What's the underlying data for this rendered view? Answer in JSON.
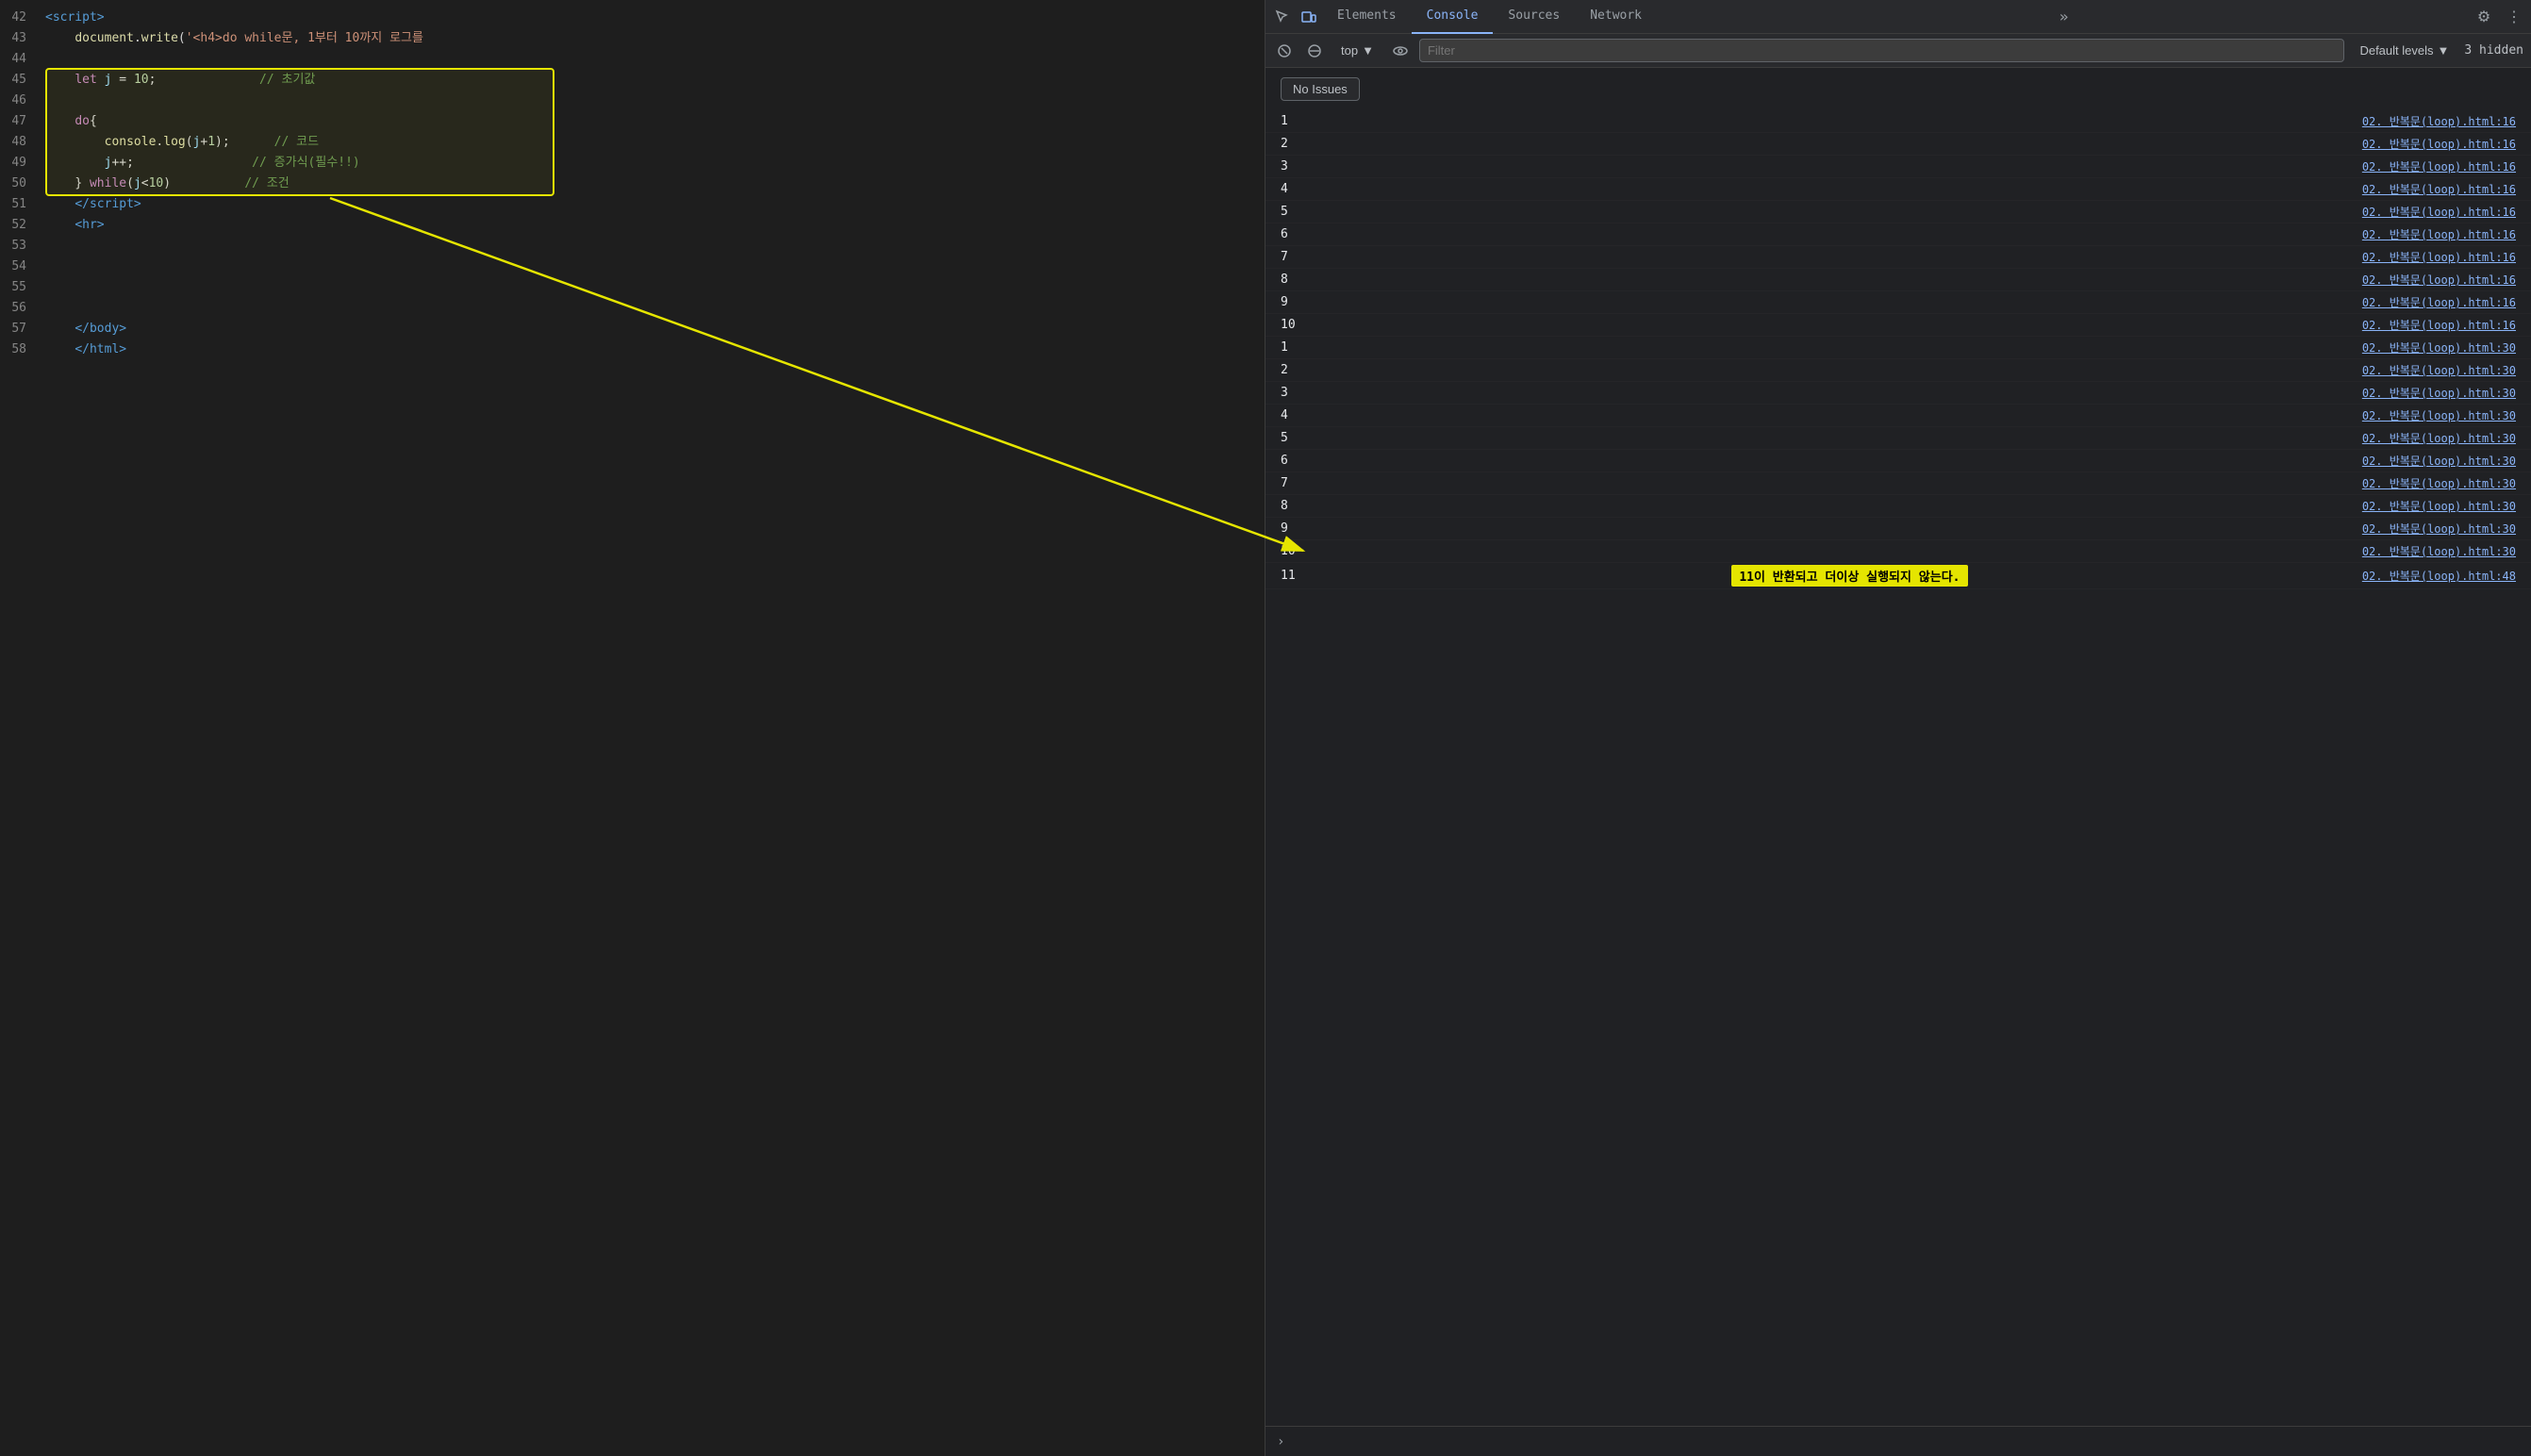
{
  "editor": {
    "lines": [
      {
        "num": 42,
        "html": "<span class='tag'>&lt;script&gt;</span>"
      },
      {
        "num": 43,
        "html": "    <span class='fn'>document</span><span class='op'>.</span><span class='fn'>write</span><span class='op'>(</span><span class='str'>'&lt;h4&gt;do while문, 1부터 10까지 로그를</span>"
      },
      {
        "num": 44,
        "html": ""
      },
      {
        "num": 45,
        "html": "    <span class='kw'>let</span> <span class='var'>j</span> <span class='op'>=</span> <span class='num'>10</span><span class='op'>;</span>              <span class='comment'>// 초기값</span>"
      },
      {
        "num": 46,
        "html": ""
      },
      {
        "num": 47,
        "html": "    <span class='kw'>do</span><span class='op'>{</span>"
      },
      {
        "num": 48,
        "html": "        <span class='fn'>console</span><span class='op'>.</span><span class='fn'>log</span><span class='op'>(</span><span class='var'>j</span><span class='op'>+</span><span class='num'>1</span><span class='op'>);</span>      <span class='comment'>// 코드</span>"
      },
      {
        "num": 49,
        "html": "        <span class='var'>j</span><span class='op'>++;</span>                <span class='comment'>// 증가식(필수!!)</span>"
      },
      {
        "num": 50,
        "html": "    <span class='op'>}</span> <span class='kw'>while</span><span class='op'>(</span><span class='var'>j</span><span class='op'>&lt;</span><span class='num'>10</span><span class='op'>)</span>          <span class='comment'>// 조건</span>"
      },
      {
        "num": 51,
        "html": "    <span class='tag'>&lt;/script&gt;</span>"
      },
      {
        "num": 52,
        "html": "    <span class='tag'>&lt;hr&gt;</span>"
      },
      {
        "num": 53,
        "html": ""
      },
      {
        "num": 54,
        "html": ""
      },
      {
        "num": 55,
        "html": ""
      },
      {
        "num": 56,
        "html": ""
      },
      {
        "num": 57,
        "html": "    <span class='tag'>&lt;/body&gt;</span>"
      },
      {
        "num": 58,
        "html": "    <span class='tag'>&lt;/html&gt;</span>"
      }
    ]
  },
  "devtools": {
    "tabs": [
      "Elements",
      "Console",
      "Sources",
      "Network"
    ],
    "active_tab": "Console",
    "toolbar": {
      "top_label": "top",
      "filter_placeholder": "Filter",
      "default_levels": "Default levels",
      "hidden_count": "3 hidden"
    },
    "no_issues": "No Issues",
    "console_rows": [
      {
        "value": "1",
        "source": "02. 반복문(loop).html:16"
      },
      {
        "value": "2",
        "source": "02. 반복문(loop).html:16"
      },
      {
        "value": "3",
        "source": "02. 반복문(loop).html:16"
      },
      {
        "value": "4",
        "source": "02. 반복문(loop).html:16"
      },
      {
        "value": "5",
        "source": "02. 반복문(loop).html:16"
      },
      {
        "value": "6",
        "source": "02. 반복문(loop).html:16"
      },
      {
        "value": "7",
        "source": "02. 반복문(loop).html:16"
      },
      {
        "value": "8",
        "source": "02. 반복문(loop).html:16"
      },
      {
        "value": "9",
        "source": "02. 반복문(loop).html:16"
      },
      {
        "value": "10",
        "source": "02. 반복문(loop).html:16"
      },
      {
        "value": "1",
        "source": "02. 반복문(loop).html:30"
      },
      {
        "value": "2",
        "source": "02. 반복문(loop).html:30"
      },
      {
        "value": "3",
        "source": "02. 반복문(loop).html:30"
      },
      {
        "value": "4",
        "source": "02. 반복문(loop).html:30"
      },
      {
        "value": "5",
        "source": "02. 반복문(loop).html:30"
      },
      {
        "value": "6",
        "source": "02. 반복문(loop).html:30"
      },
      {
        "value": "7",
        "source": "02. 반복문(loop).html:30"
      },
      {
        "value": "8",
        "source": "02. 반복문(loop).html:30"
      },
      {
        "value": "9",
        "source": "02. 반복문(loop).html:30"
      },
      {
        "value": "10",
        "source": "02. 반복문(loop).html:30",
        "highlighted": false
      },
      {
        "value": "11",
        "source": "02. 반복문(loop).html:48",
        "annotation": "11이 반환되고 더이상 실행되지 않는다."
      }
    ]
  }
}
